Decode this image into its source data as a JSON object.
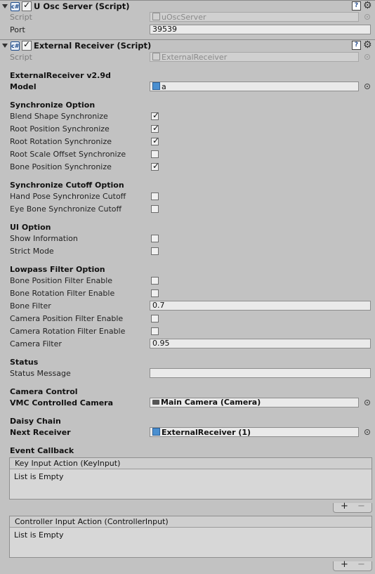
{
  "components": [
    {
      "title": "U Osc Server (Script)"
    },
    {
      "title": "External Receiver (Script)"
    }
  ],
  "osc": {
    "script_label": "Script",
    "script_value": "uOscServer",
    "port_label": "Port",
    "port_value": "39539"
  },
  "ext": {
    "script_label": "Script",
    "script_value": "ExternalReceiver",
    "version_header": "ExternalReceiver v2.9d",
    "model_label": "Model",
    "model_value": "a",
    "sync_header": "Synchronize Option",
    "blend": "Blend Shape Synchronize",
    "rootpos": "Root Position Synchronize",
    "rootrot": "Root Rotation Synchronize",
    "rootscale": "Root Scale Offset Synchronize",
    "bonepos": "Bone Position Synchronize",
    "cutoff_header": "Synchronize Cutoff Option",
    "handpose": "Hand Pose Synchronize Cutoff",
    "eyebone": "Eye Bone Synchronize Cutoff",
    "ui_header": "UI Option",
    "showinfo": "Show Information",
    "strict": "Strict Mode",
    "lowpass_header": "Lowpass Filter Option",
    "boneposfilter": "Bone Position Filter Enable",
    "bonerotfilter": "Bone Rotation Filter Enable",
    "bonefilter_label": "Bone Filter",
    "bonefilter_value": "0.7",
    "camposfilter": "Camera Position Filter Enable",
    "camrotfilter": "Camera Rotation Filter Enable",
    "camfilter_label": "Camera Filter",
    "camfilter_value": "0.95",
    "status_header": "Status",
    "statusmsg_label": "Status Message",
    "statusmsg_value": "",
    "camctrl_header": "Camera Control",
    "vmccam_label": "VMC Controlled Camera",
    "vmccam_value": "Main Camera (Camera)",
    "daisy_header": "Daisy Chain",
    "next_label": "Next Receiver",
    "next_value": "ExternalReceiver (1)",
    "event_header": "Event Callback",
    "key_title": "Key Input Action (KeyInput)",
    "key_empty": "List is Empty",
    "ctrl_title": "Controller Input Action (ControllerInput)",
    "ctrl_empty": "List is Empty"
  },
  "checks": {
    "blend": true,
    "rootpos": true,
    "rootrot": true,
    "rootscale": false,
    "bonepos": true,
    "handpose": false,
    "eyebone": false,
    "showinfo": false,
    "strict": false,
    "boneposfilter": false,
    "bonerotfilter": false,
    "camposfilter": false,
    "camrotfilter": false
  },
  "icons": {
    "foldout": "foldout-triangle-icon",
    "script": "cs-script-icon",
    "help": "help-book-icon",
    "gear": "gear-icon",
    "picker": "object-picker-icon",
    "prefab": "prefab-cube-icon",
    "camera": "camera-icon"
  },
  "list_controls": {
    "plus": "+",
    "minus": "−"
  }
}
